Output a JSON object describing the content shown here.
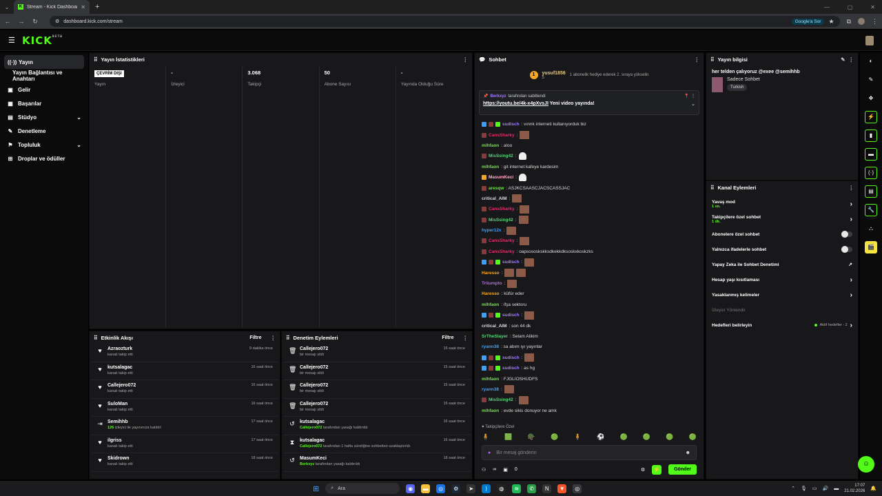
{
  "browser": {
    "tab_title": "Stream - Kick Dashboard",
    "url": "dashboard.kick.com/stream",
    "google_sor": "Google'a Sor"
  },
  "brand": {
    "logo": "KICK",
    "beta": "BETA",
    "accent": "#53fc18"
  },
  "sidebar": {
    "items": [
      {
        "label": "Yayın",
        "icon": "broadcast-icon"
      },
      {
        "label": "Yayın Bağlantısı ve Anahtarı"
      },
      {
        "label": "Gelir",
        "icon": "money-icon"
      },
      {
        "label": "Başarılar",
        "icon": "trophy-icon"
      },
      {
        "label": "Stüdyo",
        "icon": "studio-icon"
      },
      {
        "label": "Denetleme",
        "icon": "wrench-icon"
      },
      {
        "label": "Topluluk",
        "icon": "community-icon"
      },
      {
        "label": "Droplar ve ödüller",
        "icon": "gift-icon"
      }
    ]
  },
  "stats": {
    "title": "Yayın İstatistikleri",
    "offline": "ÇEVRİM DIŞI",
    "items": [
      {
        "value": "",
        "label": "Yayın"
      },
      {
        "value": "-",
        "label": "İzleyici"
      },
      {
        "value": "3.068",
        "label": "Takipçi"
      },
      {
        "value": "50",
        "label": "Abone Sayısı"
      },
      {
        "value": "-",
        "label": "Yayında Olduğu Süre"
      }
    ]
  },
  "feed": {
    "title": "Etkinlik Akışı",
    "filter": "Filtre",
    "items": [
      {
        "name": "Azraozturk",
        "desc": "kanalı takip etti",
        "time": "9 dakika önce",
        "icon": "heart-icon"
      },
      {
        "name": "kutsalagac",
        "desc": "kanalı takip etti",
        "time": "16 saat önce",
        "icon": "heart-icon"
      },
      {
        "name": "Callejero072",
        "desc": "kanalı takip etti",
        "time": "16 saat önce",
        "icon": "heart-icon"
      },
      {
        "name": "SuloMan",
        "desc": "kanalı takip etti",
        "time": "16 saat önce",
        "icon": "heart-icon"
      },
      {
        "name": "Semihhb",
        "hl": "126",
        "desc": "izleyici ile yayınınıza katıldı!",
        "time": "17 saat önce",
        "icon": "raid-icon"
      },
      {
        "name": "ilgriss",
        "desc": "kanalı takip etti",
        "time": "17 saat önce",
        "icon": "heart-icon"
      },
      {
        "name": "Skidrown",
        "desc": "kanalı takip etti",
        "time": "18 saat önce",
        "icon": "heart-icon"
      }
    ]
  },
  "moderation": {
    "title": "Denetim Eylemleri",
    "filter": "Filtre",
    "items": [
      {
        "name": "Callejero072",
        "desc": "bir mesajı sildi",
        "time": "15 saat önce",
        "icon": "trash-icon"
      },
      {
        "name": "Callejero072",
        "desc": "bir mesajı sildi",
        "time": "15 saat önce",
        "icon": "trash-icon"
      },
      {
        "name": "Callejero072",
        "desc": "bir mesajı sildi",
        "time": "15 saat önce",
        "icon": "trash-icon"
      },
      {
        "name": "Callejero072",
        "desc": "bir mesajı sildi",
        "time": "15 saat önce",
        "icon": "trash-icon"
      },
      {
        "name": "kutsalagac",
        "hl": "Callejero072",
        "desc": "tarafından yasağı kaldırıldı",
        "time": "16 saat önce",
        "icon": "undo-icon"
      },
      {
        "name": "kutsalagac",
        "hl": "Callejero072",
        "desc": "tarafından 1 hafta süreliğine sohbetten uzaklaştırıldı",
        "time": "16 saat önce",
        "icon": "hourglass-icon"
      },
      {
        "name": "MasumKeci",
        "hl": "Berkxyz",
        "desc": "tarafından yasağı kaldırıldı",
        "time": "18 saat önce",
        "icon": "undo-icon"
      }
    ]
  },
  "chat": {
    "title": "Sohbet",
    "hype": {
      "user": "yusuf1856",
      "count": "5",
      "message": "1 abonelik hediye ederek 2. sıraya yükselin"
    },
    "pinned": {
      "by": "Berkxyz",
      "by_suffix": "tarafından sabitlendi",
      "link": "https://youtu.be/4k-x4pXvsJI",
      "text": "Yeni video yayında!"
    },
    "messages": [
      {
        "user": "sudisch",
        "color": "#a07cff",
        "text": ": vınnk interneti kullanıyorduk biz",
        "badges": [
          "#3aa0ff",
          "#8b3a3a",
          "#53fc18"
        ]
      },
      {
        "user": "CansSharky",
        "color": "#e0306a",
        "text": ":",
        "badges": [
          "#8b3a3a"
        ],
        "emote": "pic"
      },
      {
        "user": "mlhfaon",
        "color": "#53fc18",
        "text": ": aloo"
      },
      {
        "user": "MisSsing42",
        "color": "#5ad17a",
        "text": ":",
        "badges": [
          "#8b3a3a"
        ],
        "emote": "white"
      },
      {
        "user": "mlhfaon",
        "color": "#53fc18",
        "text": ": git internet kafeye kardesim"
      },
      {
        "user": "MasumKeci",
        "color": "#ffb0c8",
        "text": ":",
        "badges": [
          "#f5a623"
        ],
        "emote": "white"
      },
      {
        "user": "aresqw",
        "color": "#53fc18",
        "text": ": ASJKCSAASCJACSCASSJAC",
        "badges": [
          "#8b3a3a"
        ]
      },
      {
        "user": "critical_AIM",
        "color": "#dddddd",
        "text": ":",
        "emote": "pic"
      },
      {
        "user": "CansSharky",
        "color": "#e0306a",
        "text": ":",
        "badges": [
          "#8b3a3a"
        ],
        "emote": "pic"
      },
      {
        "user": "MisSsing42",
        "color": "#5ad17a",
        "text": ":",
        "badges": [
          "#8b3a3a"
        ],
        "emote": "pic"
      },
      {
        "user": "hyper12x",
        "color": "#3aa0ff",
        "text": ":",
        "emote": "pic"
      },
      {
        "user": "CansSharky",
        "color": "#e0306a",
        "text": ":",
        "badges": [
          "#8b3a3a"
        ],
        "emote": "pic"
      },
      {
        "user": "CansSharky",
        "color": "#e0306a",
        "text": ": oapsososkskksdkekkdksoskxkoskzks",
        "badges": [
          "#8b3a3a"
        ]
      },
      {
        "user": "sudisch",
        "color": "#a07cff",
        "text": ":",
        "badges": [
          "#3aa0ff",
          "#8b3a3a",
          "#53fc18"
        ],
        "emote": "pic"
      },
      {
        "user": "Haresso",
        "color": "#f5a623",
        "text": ":",
        "emote": "pic2"
      },
      {
        "user": "Triiumpto",
        "color": "#c35cff",
        "text": ":",
        "emote": "pic"
      },
      {
        "user": "Haresso",
        "color": "#f5a623",
        "text": ": küfür eder"
      },
      {
        "user": "mlhfaon",
        "color": "#53fc18",
        "text": ": ifşa sektoru"
      },
      {
        "user": "sudisch",
        "color": "#a07cff",
        "text": ":",
        "badges": [
          "#3aa0ff",
          "#8b3a3a",
          "#53fc18"
        ],
        "emote": "pic"
      },
      {
        "user": "critical_AIM",
        "color": "#dddddd",
        "text": ": son 44 dk"
      },
      {
        "user": "SrTheSlayer",
        "color": "#5ad17a",
        "text": ": Selam Alikim"
      },
      {
        "user": "ryann38",
        "color": "#3aa0ff",
        "text": ": sa abım ıyı yayınlar"
      },
      {
        "user": "sudisch",
        "color": "#a07cff",
        "text": ":",
        "badges": [
          "#3aa0ff",
          "#8b3a3a",
          "#53fc18"
        ],
        "emote": "pic"
      },
      {
        "user": "sudisch",
        "color": "#a07cff",
        "text": ": as hg",
        "badges": [
          "#3aa0ff",
          "#8b3a3a",
          "#53fc18"
        ]
      },
      {
        "user": "mlhfaon",
        "color": "#53fc18",
        "text": ": FJGLIOSHUDFS"
      },
      {
        "user": "ryann38",
        "color": "#3aa0ff",
        "text": ":",
        "emote": "pic"
      },
      {
        "user": "MisSsing42",
        "color": "#5ad17a",
        "text": ":",
        "badges": [
          "#8b3a3a"
        ],
        "emote": "pic"
      },
      {
        "user": "mlhfaon",
        "color": "#53fc18",
        "text": ": evde sikis donuyor ne amk"
      }
    ],
    "followers_only": "Takipçilere Özel",
    "placeholder": "Bir mesaj gönderin",
    "infinity": "∞",
    "points": "0",
    "send": "Gönder"
  },
  "stream_info": {
    "title_label": "Yayın bilgisi",
    "title": "her telden çalıyoruz @exee @semihhb",
    "category": "Sadece Sohbet",
    "tag": "Turkish"
  },
  "channel_actions": {
    "title": "Kanal Eylemleri",
    "items": [
      {
        "label": "Yavaş mod",
        "sub": "1 sn.",
        "type": "chevron"
      },
      {
        "label": "Takipçilere özel sohbet",
        "sub": "1 dk.",
        "type": "chevron"
      },
      {
        "label": "Abonelere özel sohbet",
        "type": "toggle"
      },
      {
        "label": "Yalnızca ifadelerle sohbet",
        "type": "toggle"
      },
      {
        "label": "Yapay Zeka ile Sohbet Denetimi",
        "type": "external"
      },
      {
        "label": "Hesap yaşı kısıtlaması",
        "type": "chevron"
      },
      {
        "label": "Yasaklanmış kelimeler",
        "type": "chevron"
      },
      {
        "label": "İzleyici Yönlendir",
        "type": "dim"
      },
      {
        "label": "Hedefleri belirleyin",
        "type": "chevron",
        "note": "Aktif hedefler - 2"
      }
    ]
  },
  "taskbar": {
    "search": "Ara",
    "time": "17:07",
    "date": "21.02.2026"
  }
}
